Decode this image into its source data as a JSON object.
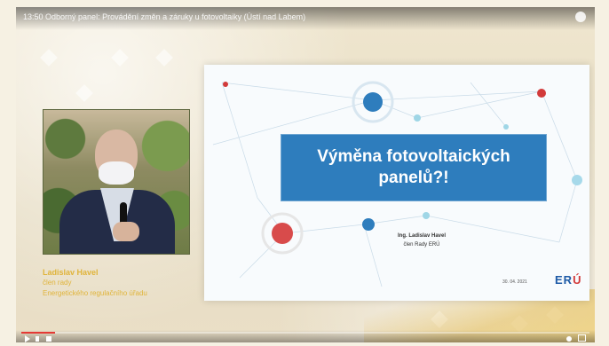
{
  "video": {
    "title": "13:50 Odborný panel: Provádění změn a záruky u fotovoltaiky (Ústí nad Labem)",
    "progress": 0.06
  },
  "speaker": {
    "name": "Ladislav Havel",
    "role": "člen rady",
    "organization": "Energetického regulačního úřadu"
  },
  "slide": {
    "title": "Výměna fotovoltaických panelů?!",
    "presenter_name": "Ing. Ladislav Havel",
    "presenter_role": "člen Rady ERÚ",
    "date": "30. 04. 2021",
    "logo_text_main": "ER",
    "logo_text_accent": "Ú"
  },
  "colors": {
    "slide_title_bg": "#2e7dbd",
    "accent_red": "#d23a3a",
    "accent_gold": "#e0b43a",
    "logo_blue": "#1d5aa6"
  },
  "icons": [
    "info-icon",
    "play-icon",
    "skip-icon",
    "volume-icon",
    "settings-icon",
    "fullscreen-icon"
  ]
}
